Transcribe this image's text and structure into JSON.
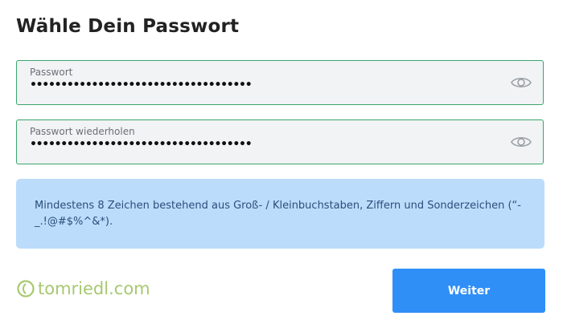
{
  "page": {
    "title": "Wähle Dein Passwort"
  },
  "fields": [
    {
      "label": "Passwort",
      "value": "••••••••••••••••••••••••••••••••••••"
    },
    {
      "label": "Passwort wiederholen",
      "value": "••••••••••••••••••••••••••••••••••••"
    }
  ],
  "info": {
    "text": "Mindestens 8 Zeichen bestehend aus Groß- / Kleinbuchstaben, Ziffern und Sonderzeichen (“-_.!@#$%^&*)."
  },
  "brand": {
    "text": "tomriedl.com",
    "color": "#a7c870"
  },
  "actions": {
    "next_label": "Weiter",
    "accent": "#2f8ff7"
  },
  "icons": {
    "toggle_visibility": "eye-icon"
  },
  "colors": {
    "field_border": "#3aa56a",
    "info_bg": "#bcdcfc"
  }
}
